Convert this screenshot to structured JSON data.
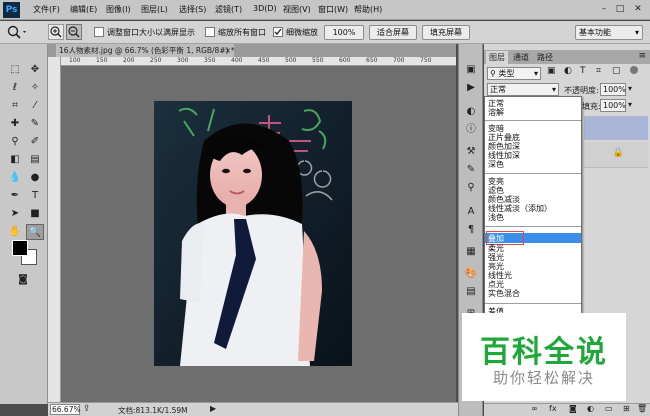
{
  "menubar": {
    "app_logo": "Ps",
    "items": [
      "文件(F)",
      "编辑(E)",
      "图像(I)",
      "图层(L)",
      "选择(S)",
      "滤镜(T)",
      "3D(D)",
      "视图(V)",
      "窗口(W)",
      "帮助(H)"
    ],
    "window_buttons": [
      "–",
      "□",
      "✕"
    ]
  },
  "options_bar": {
    "check_resize_window": "调整窗口大小以满屏显示",
    "check_zoom_all": "缩放所有窗口",
    "check_scrubby_zoom": "细微缩放",
    "zoom_100": "100%",
    "fit_screen": "适合屏幕",
    "fill_screen": "填充屏幕",
    "workspace": "基本功能"
  },
  "document": {
    "tab_title": "16人物素材.jpg @ 66.7% (色彩平衡 1, RGB/8#) *",
    "ruler_ticks": [
      "100",
      "150",
      "200",
      "250",
      "300",
      "350",
      "400",
      "450",
      "500",
      "550",
      "600",
      "650",
      "700",
      "750"
    ],
    "zoom": "66.67%",
    "doc_size": "文档:813.1K/1.59M"
  },
  "layers_panel": {
    "tabs": [
      "图层",
      "通道",
      "路径"
    ],
    "kind_filter": "类型",
    "blend_mode": "正常",
    "opacity_label": "不透明度:",
    "opacity_value": "100%",
    "fill_label": "填充:",
    "fill_value": "100%"
  },
  "blend_modes": {
    "group1": [
      "正常",
      "溶解"
    ],
    "group2": [
      "变暗",
      "正片叠底",
      "颜色加深",
      "线性加深",
      "深色"
    ],
    "group3": [
      "变亮",
      "滤色",
      "颜色减淡",
      "线性减淡（添加）",
      "浅色"
    ],
    "group4": [
      "叠加",
      "柔光",
      "强光",
      "亮光",
      "线性光",
      "点光",
      "实色混合"
    ],
    "group5": [
      "差值"
    ],
    "selected": "叠加"
  },
  "watermark": {
    "title": "百科全说",
    "subtitle": "助你轻松解决"
  },
  "colors": {
    "accent_selected": "#3b8fe8",
    "highlight_box": "#e04a4a",
    "watermark_green": "#1fa83a"
  }
}
